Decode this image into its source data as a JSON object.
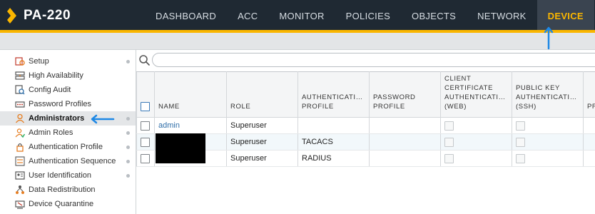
{
  "app": {
    "name": "PA-220",
    "brand_color": "#fab600",
    "nav_color": "#1f2933"
  },
  "nav": {
    "tabs": [
      {
        "label": "DASHBOARD"
      },
      {
        "label": "ACC"
      },
      {
        "label": "MONITOR"
      },
      {
        "label": "POLICIES"
      },
      {
        "label": "OBJECTS"
      },
      {
        "label": "NETWORK"
      },
      {
        "label": "DEVICE",
        "active": true
      }
    ]
  },
  "sidebar": {
    "items": [
      {
        "label": "Setup",
        "icon": "setup-icon",
        "dot": true
      },
      {
        "label": "High Availability",
        "icon": "high-availability-icon"
      },
      {
        "label": "Config Audit",
        "icon": "config-audit-icon"
      },
      {
        "label": "Password Profiles",
        "icon": "password-profile-icon"
      },
      {
        "label": "Administrators",
        "icon": "administrator-icon",
        "dot": true,
        "active": true
      },
      {
        "label": "Admin Roles",
        "icon": "admin-roles-icon",
        "dot": true
      },
      {
        "label": "Authentication Profile",
        "icon": "authentication-profile-icon",
        "dot": true
      },
      {
        "label": "Authentication Sequence",
        "icon": "authentication-sequence-icon",
        "dot": true
      },
      {
        "label": "User Identification",
        "icon": "user-identification-icon",
        "dot": true
      },
      {
        "label": "Data Redistribution",
        "icon": "data-redistribution-icon"
      },
      {
        "label": "Device Quarantine",
        "icon": "device-quarantine-icon"
      }
    ]
  },
  "search": {
    "value": "",
    "placeholder": ""
  },
  "table": {
    "columns": [
      "",
      "NAME",
      "ROLE",
      "AUTHENTICATI…\nPROFILE",
      "PASSWORD\nPROFILE",
      "CLIENT\nCERTIFICATE\nAUTHENTICATI…\n(WEB)",
      "PUBLIC KEY\nAUTHENTICATI…\n(SSH)",
      "PR"
    ],
    "rows": [
      {
        "name": "admin",
        "role": "Superuser",
        "auth_profile": "",
        "password_profile": ""
      },
      {
        "name": "",
        "role": "Superuser",
        "auth_profile": "TACACS",
        "password_profile": ""
      },
      {
        "name": "",
        "role": "Superuser",
        "auth_profile": "RADIUS",
        "password_profile": ""
      }
    ]
  },
  "annotation_color": "#1e88e5"
}
